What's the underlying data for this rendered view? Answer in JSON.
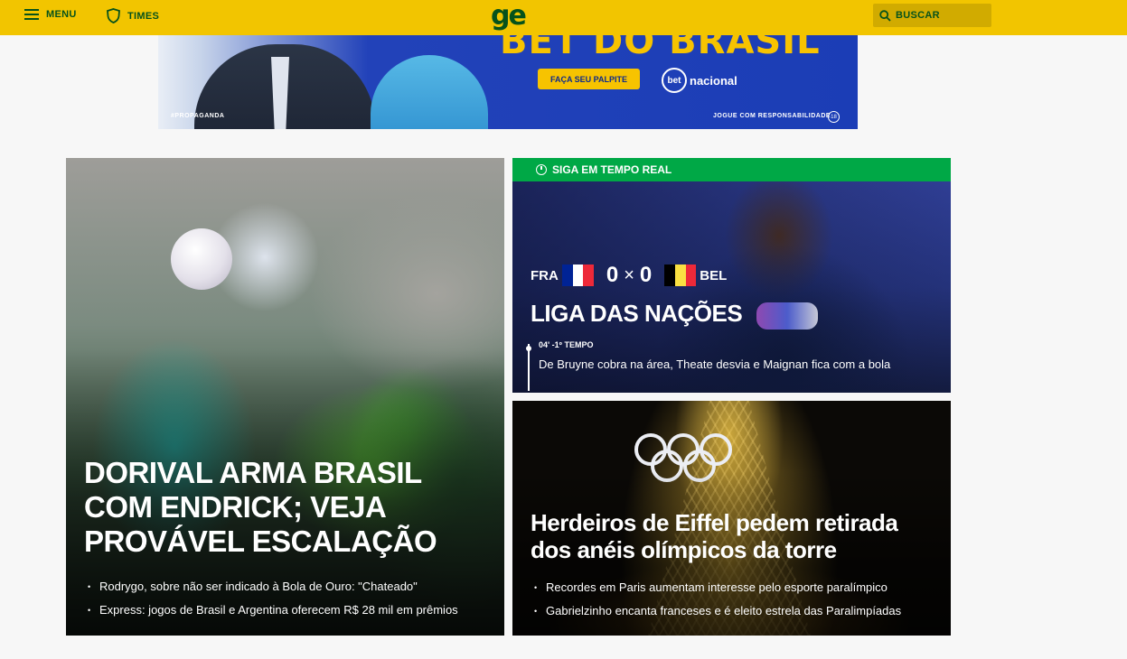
{
  "header": {
    "menu_label": "MENU",
    "times_label": "TIMES",
    "logo": "ge",
    "search_label": "BUSCAR"
  },
  "ad": {
    "headline": "BET DO BRASIL",
    "cta": "FAÇA SEU PALPITE",
    "brand_mark": "bet",
    "brand_name": "nacional",
    "tag": "#PROPAGANDA",
    "responsibility": "JOGUE COM RESPONSABILIDADE",
    "age": "18"
  },
  "main_story": {
    "title": "DORIVAL ARMA BRASIL COM ENDRICK; VEJA PROVÁVEL ESCALAÇÃO",
    "related": [
      "Rodrygo, sobre não ser indicado à Bola de Ouro: \"Chateado\"",
      "Express: jogos de Brasil e Argentina oferecem R$ 28 mil em prêmios"
    ]
  },
  "live_story": {
    "banner": "SIGA EM TEMPO REAL",
    "home_team": "FRA",
    "home_score": "0",
    "separator": "×",
    "away_score": "0",
    "away_team": "BEL",
    "title": "LIGA DAS NAÇÕES",
    "time": "04' -1º TEMPO",
    "update": "De Bruyne cobra na área, Theate desvia e Maignan fica com a bola",
    "colors": {
      "banner": "#00a846",
      "france": [
        "#002395",
        "#ffffff",
        "#ed2939"
      ],
      "belgium": [
        "#000000",
        "#fae042",
        "#ed2939"
      ]
    }
  },
  "eiffel_story": {
    "title": "Herdeiros de Eiffel pedem retirada dos anéis olímpicos da torre",
    "related": [
      "Recordes em Paris aumentam interesse pelo esporte paralímpico",
      "Gabrielzinho encanta franceses e é eleito estrela das Paralimpíadas"
    ]
  },
  "colors": {
    "header_bg": "#f2c500",
    "brand_green": "#06521b",
    "live_green": "#00a846"
  }
}
